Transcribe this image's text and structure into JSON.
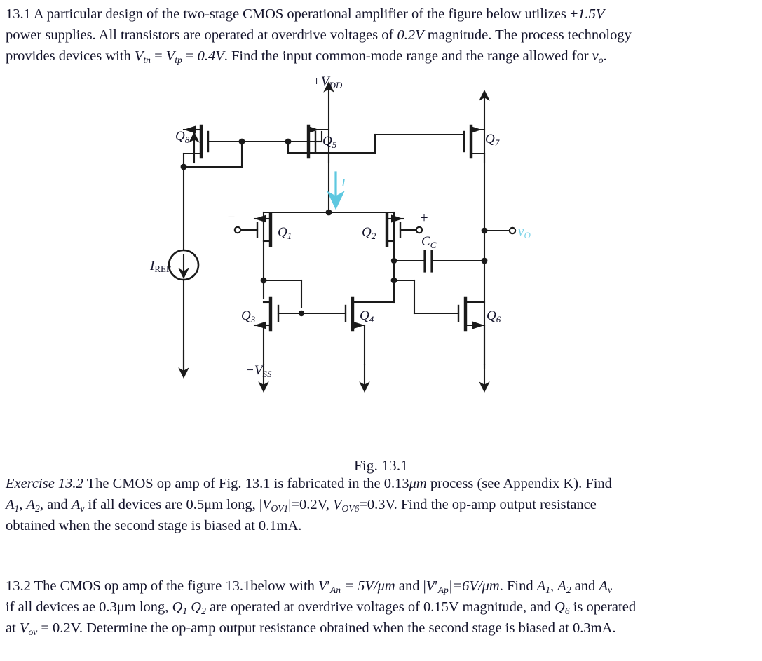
{
  "document": {
    "background_color": "#ffffff",
    "text_color": "#14142b",
    "accent_color": "#5ec8e0"
  },
  "problem_131": {
    "number": "13.1",
    "line1_a": "A particular design of the two-stage CMOS operational amplifier of the figure below utilizes ",
    "line1_b": "±1.5V",
    "line2_a": "power supplies. All transistors are operated at overdrive voltages of ",
    "line2_b": "0.2V",
    "line2_c": " magnitude. The process technology",
    "line3_a": "provides devices with ",
    "line3_v1": "V",
    "line3_v1sub": "tn",
    "line3_eq1": " = ",
    "line3_v2": "V",
    "line3_v2sub": "tp",
    "line3_eq2": " = ",
    "line3_val": "0.4V",
    "line3_end": ". Find the input common-mode range and the range allowed for ",
    "line3_vo": "v",
    "line3_vosub": "o",
    "line3_period": "."
  },
  "figure": {
    "caption": "Fig. 13.1",
    "labels": {
      "vdd": "+V",
      "vdd_sub": "DD",
      "vss_minus": "−V",
      "vss_sub": "SS",
      "iref": "I",
      "iref_sub": "REF",
      "current_I": "I",
      "vo": "v",
      "vo_sub": "O",
      "cc": "C",
      "cc_sub": "C",
      "q1": "Q",
      "q1_sub": "1",
      "q2": "Q",
      "q2_sub": "2",
      "q3": "Q",
      "q3_sub": "3",
      "q4": "Q",
      "q4_sub": "4",
      "q5": "Q",
      "q5_sub": "5",
      "q6": "Q",
      "q6_sub": "6",
      "q7": "Q",
      "q7_sub": "7",
      "q8": "Q",
      "q8_sub": "8",
      "input_minus": "−",
      "input_plus": "+"
    },
    "colors": {
      "wire": "#1a1a1a",
      "current_arrow": "#5ec8e0",
      "vo_label": "#7fd4e8"
    }
  },
  "exercise_132": {
    "title": "Exercise 13.2",
    "l1": " The CMOS op amp of Fig. 13.1 is fabricated in the 0.13",
    "l1_um": "μm",
    "l1_b": " process (see Appendix K). Find",
    "l2_a1": "A",
    "l2_a1sub": "1",
    "l2_c1": ", ",
    "l2_a2": "A",
    "l2_a2sub": "2",
    "l2_c2": ", and ",
    "l2_av": "A",
    "l2_avsub": "v",
    "l2_mid": " if all devices are 0.5μm long, |",
    "l2_v1": "V",
    "l2_v1sub": "OV1",
    "l2_v1val": "|=0.2V, ",
    "l2_v2": "V",
    "l2_v2sub": "OV6",
    "l2_v2val": "=0.3V. Find the op-amp output resistance",
    "l3": "obtained when the second stage is biased at 0.1mA."
  },
  "problem_132": {
    "number": "13.2",
    "l1_a": " The CMOS op amp of the figure 13.1below with ",
    "l1_v1": "V",
    "l1_v1prime": "′",
    "l1_v1sub": "An",
    "l1_eq": " = 5V/",
    "l1_um1": "μm",
    "l1_and": "  and |",
    "l1_v2": "V",
    "l1_v2prime": "′",
    "l1_v2sub": "Ap",
    "l1_eq2": "|=6V/",
    "l1_um2": "μm",
    "l1_end": ". Find ",
    "l1_a1": "A",
    "l1_a1sub": "1",
    "l1_c1": ", ",
    "l1_a2": "A",
    "l1_a2sub": "2",
    "l1_and2": " and ",
    "l1_av": "A",
    "l1_avsub": "v",
    "l2_a": "if all devices ae 0.3μm long, ",
    "l2_q1": "Q",
    "l2_q1sub": "1",
    "l2_sp": " ",
    "l2_q2": "Q",
    "l2_q2sub": "2",
    "l2_b": " are operated at overdrive voltages of 0.15V magnitude, and ",
    "l2_q6": "Q",
    "l2_q6sub": "6",
    "l2_c": " is operated",
    "l3_a": "at ",
    "l3_v": "V",
    "l3_vsub": "ov",
    "l3_b": " = 0.2V. Determine the op-amp output resistance obtained when the second stage is biased at 0.3mA."
  }
}
